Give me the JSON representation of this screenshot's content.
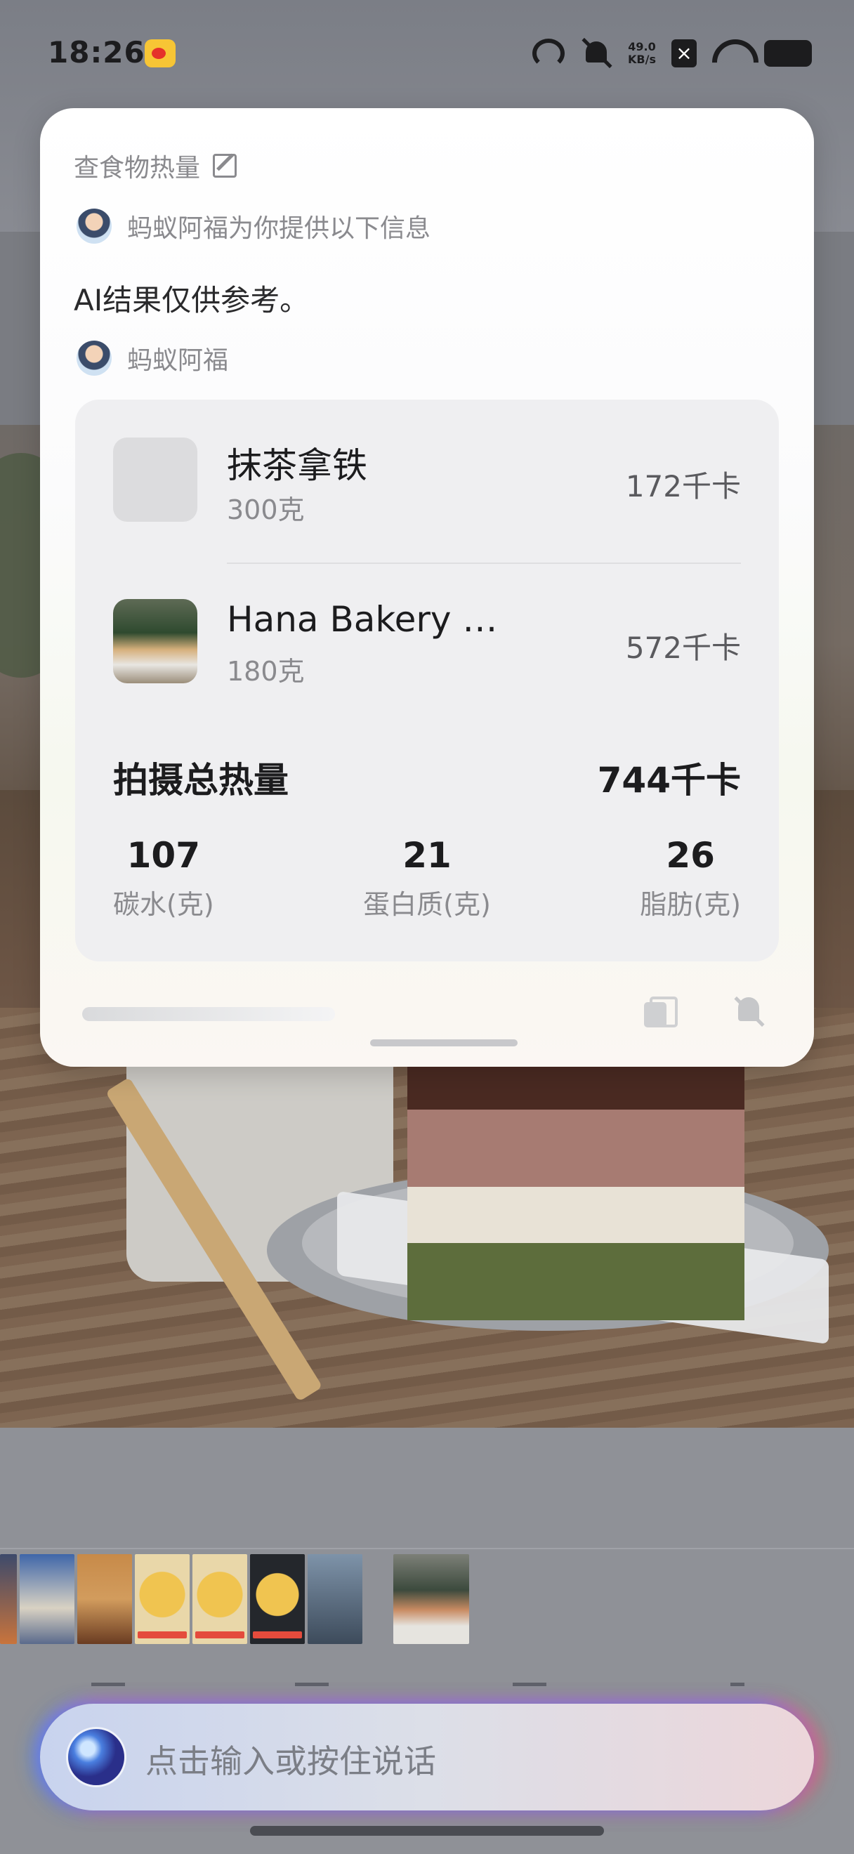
{
  "statusbar": {
    "time": "18:26",
    "speed_value": "49.0",
    "speed_unit": "KB/s",
    "icons": [
      "weibo-icon",
      "data-saver-icon",
      "mute-bell-icon",
      "no-sim-icon",
      "wifi-icon",
      "battery-icon"
    ]
  },
  "card": {
    "query": "查食物热量",
    "assistant_intro": "蚂蚁阿福为你提供以下信息",
    "disclaimer": "AI结果仅供参考。",
    "assistant_name": "蚂蚁阿福",
    "foods": [
      {
        "name": "抹茶拿铁",
        "weight": "300克",
        "calories": "172千卡"
      },
      {
        "name": "Hana Bakery …",
        "weight": "180克",
        "calories": "572千卡"
      }
    ],
    "total_label": "拍摄总热量",
    "total_value": "744千卡",
    "nutrients": [
      {
        "value": "107",
        "label": "碳水(克)"
      },
      {
        "value": "21",
        "label": "蛋白质(克)"
      },
      {
        "value": "26",
        "label": "脂肪(克)"
      }
    ]
  },
  "input": {
    "placeholder": "点击输入或按住说话"
  },
  "colors": {
    "card_bg": "#ffffff",
    "panel_bg": "#efeff1",
    "glow_left": "#3c82ff",
    "glow_right": "#ff505a"
  }
}
